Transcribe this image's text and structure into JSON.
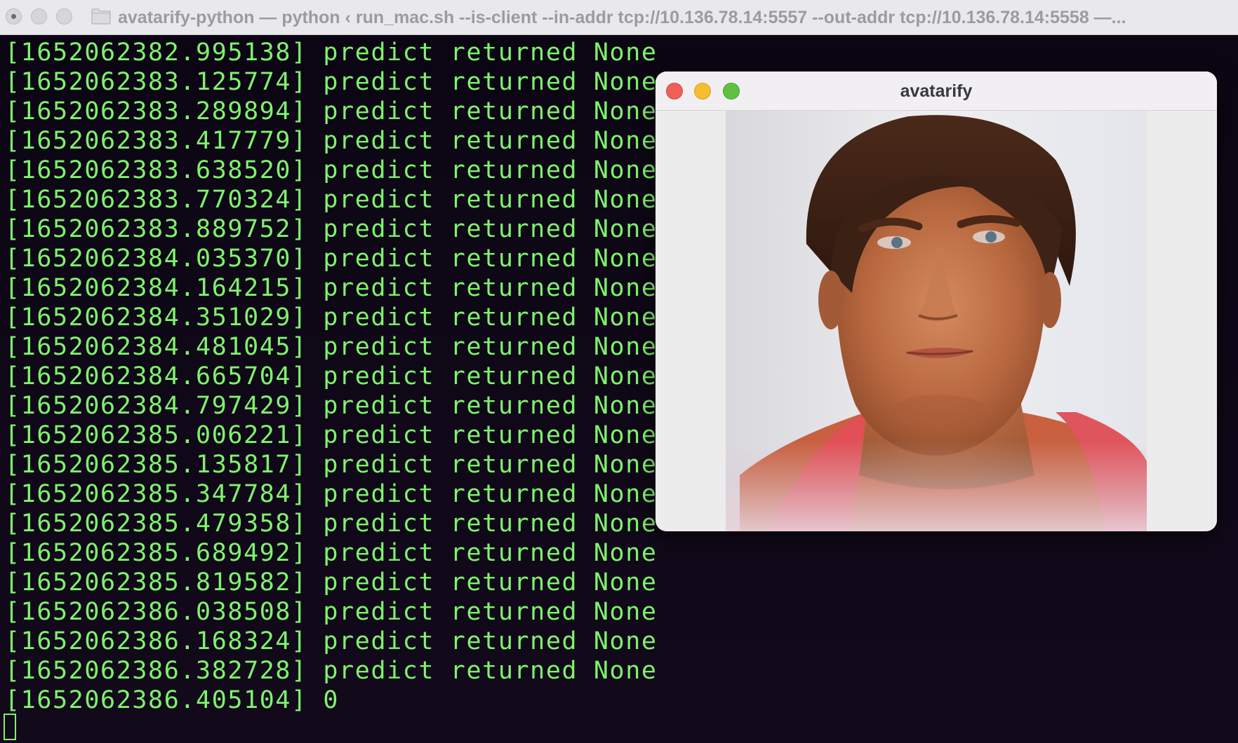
{
  "terminal": {
    "title": "avatarify-python — python ‹ run_mac.sh --is-client --in-addr tcp://10.136.78.14:5557 --out-addr tcp://10.136.78.14:5558 —...",
    "text_color": "#7ef36c",
    "background": "#0d0616",
    "lines": [
      "[1652062382.995138] predict returned None",
      "[1652062383.125774] predict returned None",
      "[1652062383.289894] predict returned None",
      "[1652062383.417779] predict returned None",
      "[1652062383.638520] predict returned None",
      "[1652062383.770324] predict returned None",
      "[1652062383.889752] predict returned None",
      "[1652062384.035370] predict returned None",
      "[1652062384.164215] predict returned None",
      "[1652062384.351029] predict returned None",
      "[1652062384.481045] predict returned None",
      "[1652062384.665704] predict returned None",
      "[1652062384.797429] predict returned None",
      "[1652062385.006221] predict returned None",
      "[1652062385.135817] predict returned None",
      "[1652062385.347784] predict returned None",
      "[1652062385.479358] predict returned None",
      "[1652062385.689492] predict returned None",
      "[1652062385.819582] predict returned None",
      "[1652062386.038508] predict returned None",
      "[1652062386.168324] predict returned None",
      "[1652062386.382728] predict returned None",
      "[1652062386.405104] 0"
    ]
  },
  "preview_window": {
    "title": "avatarify",
    "image_description_icon": "avatar-face-image"
  },
  "colors": {
    "close": "#ee5f57",
    "minimize": "#f5bd30",
    "maximize": "#5fc140"
  }
}
